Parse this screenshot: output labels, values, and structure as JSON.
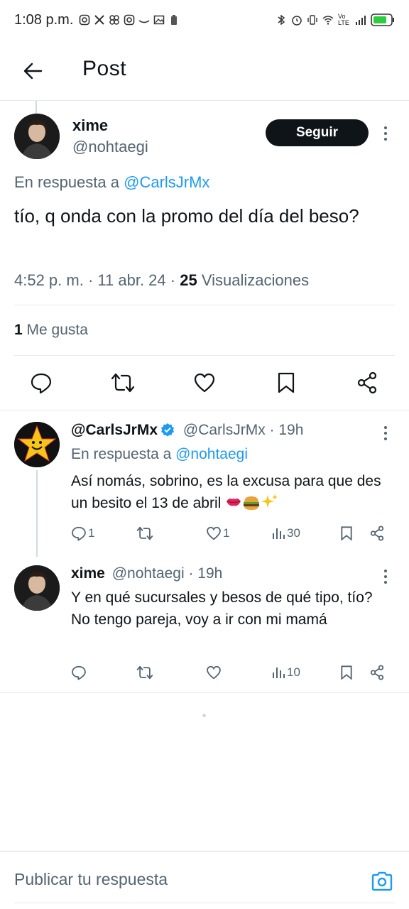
{
  "status_bar": {
    "time": "1:08 p.m.",
    "icons_left": [
      "instagram-icon",
      "x-icon",
      "pinwheel-icon",
      "instagram-icon",
      "amazon-icon",
      "gallery-icon",
      "battery-saver-icon"
    ],
    "icons_right": [
      "bluetooth-icon",
      "alarm-icon",
      "vibrate-icon",
      "wifi-icon",
      "volte-icon",
      "signal-icon",
      "battery-icon"
    ],
    "volte_label": "Vo LTE",
    "battery_color": "#2ecc40"
  },
  "header": {
    "title": "Post"
  },
  "main_post": {
    "name": "xime",
    "handle": "@nohtaegi",
    "follow_label": "Seguir",
    "reply_prefix": "En respuesta a",
    "reply_to": "@CarlsJrMx",
    "text": "tío, q onda con la promo del día del beso?",
    "time": "4:52 p. m.",
    "date": "11 abr. 24",
    "views_count": "25",
    "views_label": "Visualizaciones",
    "likes_count": "1",
    "likes_label": "Me gusta"
  },
  "replies": [
    {
      "name": "@CarlsJrMx",
      "verified": true,
      "handle": "@CarlsJrMx",
      "time": "19h",
      "reply_prefix": "En respuesta a",
      "reply_to": "@nohtaegi",
      "text": "Así nomás, sobrino, es la excusa para que des un besito el 13 de abril",
      "emojis": [
        "kiss-mark",
        "burger",
        "sparkles"
      ],
      "replies_count": "1",
      "reposts_count": "",
      "likes_count": "1",
      "views_count": "30"
    },
    {
      "name": "xime",
      "verified": false,
      "handle": "@nohtaegi",
      "time": "19h",
      "text": "Y en qué sucursales y besos de qué tipo, tío? No tengo pareja, voy a ir con mi mamá",
      "replies_count": "",
      "reposts_count": "",
      "likes_count": "",
      "views_count": "10"
    }
  ],
  "compose": {
    "placeholder": "Publicar tu respuesta"
  },
  "colors": {
    "accent": "#1d9bf0",
    "text": "#0f1419",
    "secondary": "#536471",
    "follow_bg": "#0f1419",
    "brand_star": "#f5c518"
  }
}
